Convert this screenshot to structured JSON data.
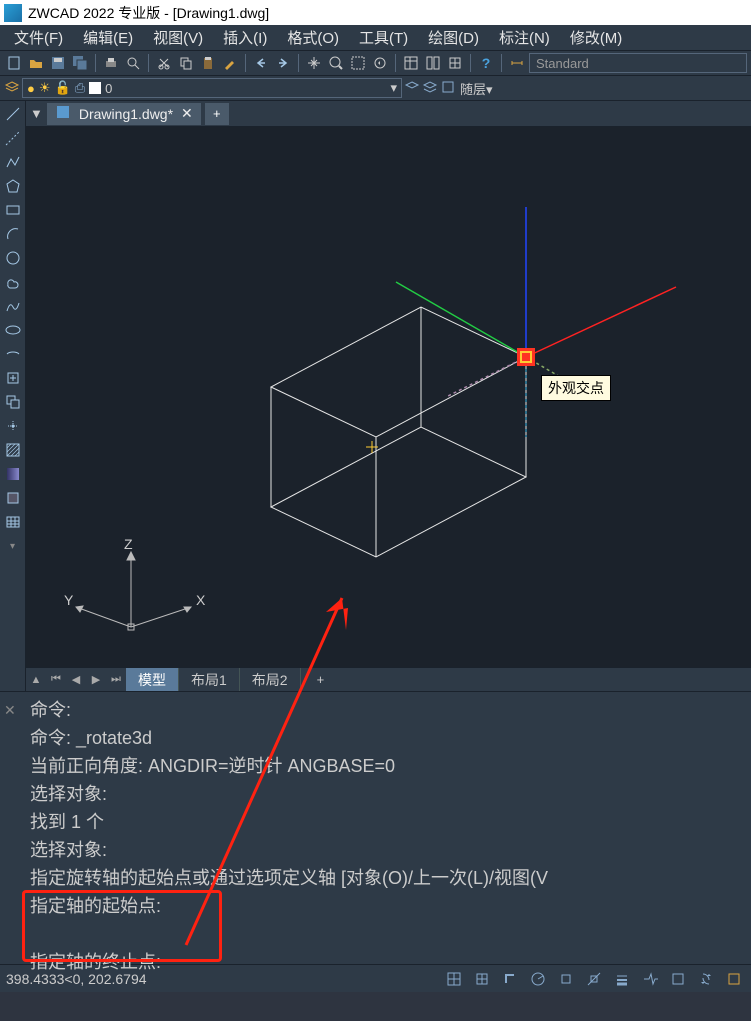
{
  "titlebar": {
    "text": "ZWCAD 2022 专业版 - [Drawing1.dwg]"
  },
  "menu": {
    "file": "文件(F)",
    "edit": "编辑(E)",
    "view": "视图(V)",
    "insert": "插入(I)",
    "format": "格式(O)",
    "tools": "工具(T)",
    "draw": "绘图(D)",
    "annotate": "标注(N)",
    "modify": "修改(M)"
  },
  "toolbar": {
    "style_combo": "Standard"
  },
  "layer": {
    "current": "0",
    "layer_combo_placeholder": "随层"
  },
  "doc_tab": {
    "name": "Drawing1.dwg*",
    "close": "✕",
    "add": "+"
  },
  "tooltip": {
    "snap_type": "外观交点"
  },
  "ucs": {
    "x": "X",
    "y": "Y",
    "z": "Z"
  },
  "layout_tabs": {
    "model": "模型",
    "layout1": "布局1",
    "layout2": "布局2",
    "add": "+"
  },
  "command": {
    "lines": [
      "命令:",
      "命令: _rotate3d",
      "当前正向角度:   ANGDIR=逆时针   ANGBASE=0",
      "选择对象:",
      "找到 1 个",
      "选择对象:",
      "指定旋转轴的起始点或通过选项定义轴 [对象(O)/上一次(L)/视图(V",
      "指定轴的起始点:",
      "",
      "指定轴的终止点:"
    ]
  },
  "status": {
    "coords": "398.4333<0, 202.6794"
  },
  "icons": {
    "new": "🗋",
    "open": "📂",
    "save": "💾",
    "cut": "✂",
    "copy": "⎘",
    "paste": "📋",
    "undo": "↶",
    "redo": "↷",
    "pan": "✋",
    "zoom": "🔍",
    "help": "?"
  }
}
